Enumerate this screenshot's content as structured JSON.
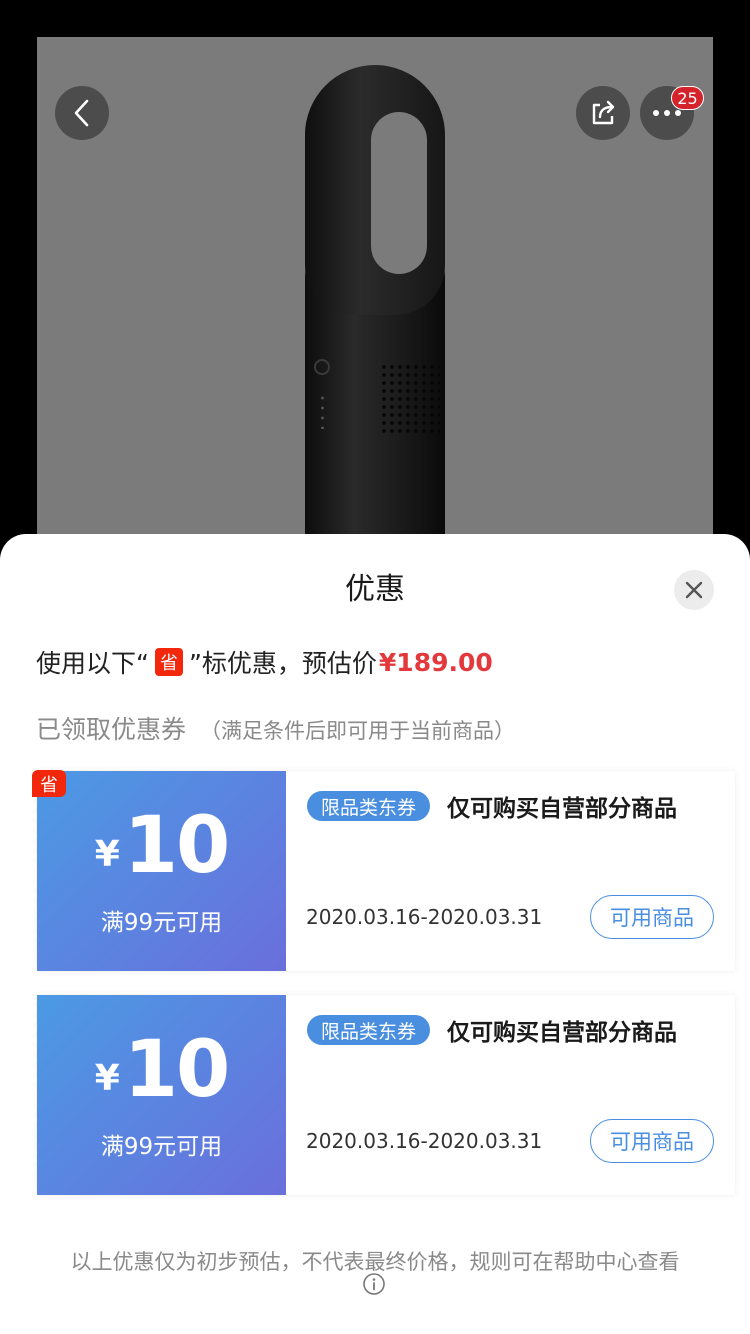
{
  "product": {
    "badge_count": "25"
  },
  "sheet": {
    "title": "优惠",
    "estimate_prefix": "使用以下“",
    "estimate_tag": "省",
    "estimate_suffix": "”标优惠，预估价",
    "estimate_price": "¥189.00",
    "section_main": "已领取优惠券",
    "section_sub": "（满足条件后即可用于当前商品）",
    "footer_note": "以上优惠仅为初步预估，不代表最终价格，规则可在帮助中心查看"
  },
  "coupons": [
    {
      "corner_tag": "省",
      "currency": "¥",
      "amount": "10",
      "condition": "满99元可用",
      "type_tag": "限品类东券",
      "description": "仅可购买自营部分商品",
      "date_range": "2020.03.16-2020.03.31",
      "button_label": "可用商品"
    },
    {
      "currency": "¥",
      "amount": "10",
      "condition": "满99元可用",
      "type_tag": "限品类东券",
      "description": "仅可购买自营部分商品",
      "date_range": "2020.03.16-2020.03.31",
      "button_label": "可用商品"
    }
  ],
  "colors": {
    "accent_red": "#e4393c",
    "tag_red": "#f2270c",
    "coupon_blue": "#4a8ee0",
    "coupon_gradient_end": "#6a6fdc"
  },
  "icons": [
    "back-arrow-icon",
    "share-icon",
    "more-dots-icon",
    "close-icon",
    "info-icon"
  ]
}
